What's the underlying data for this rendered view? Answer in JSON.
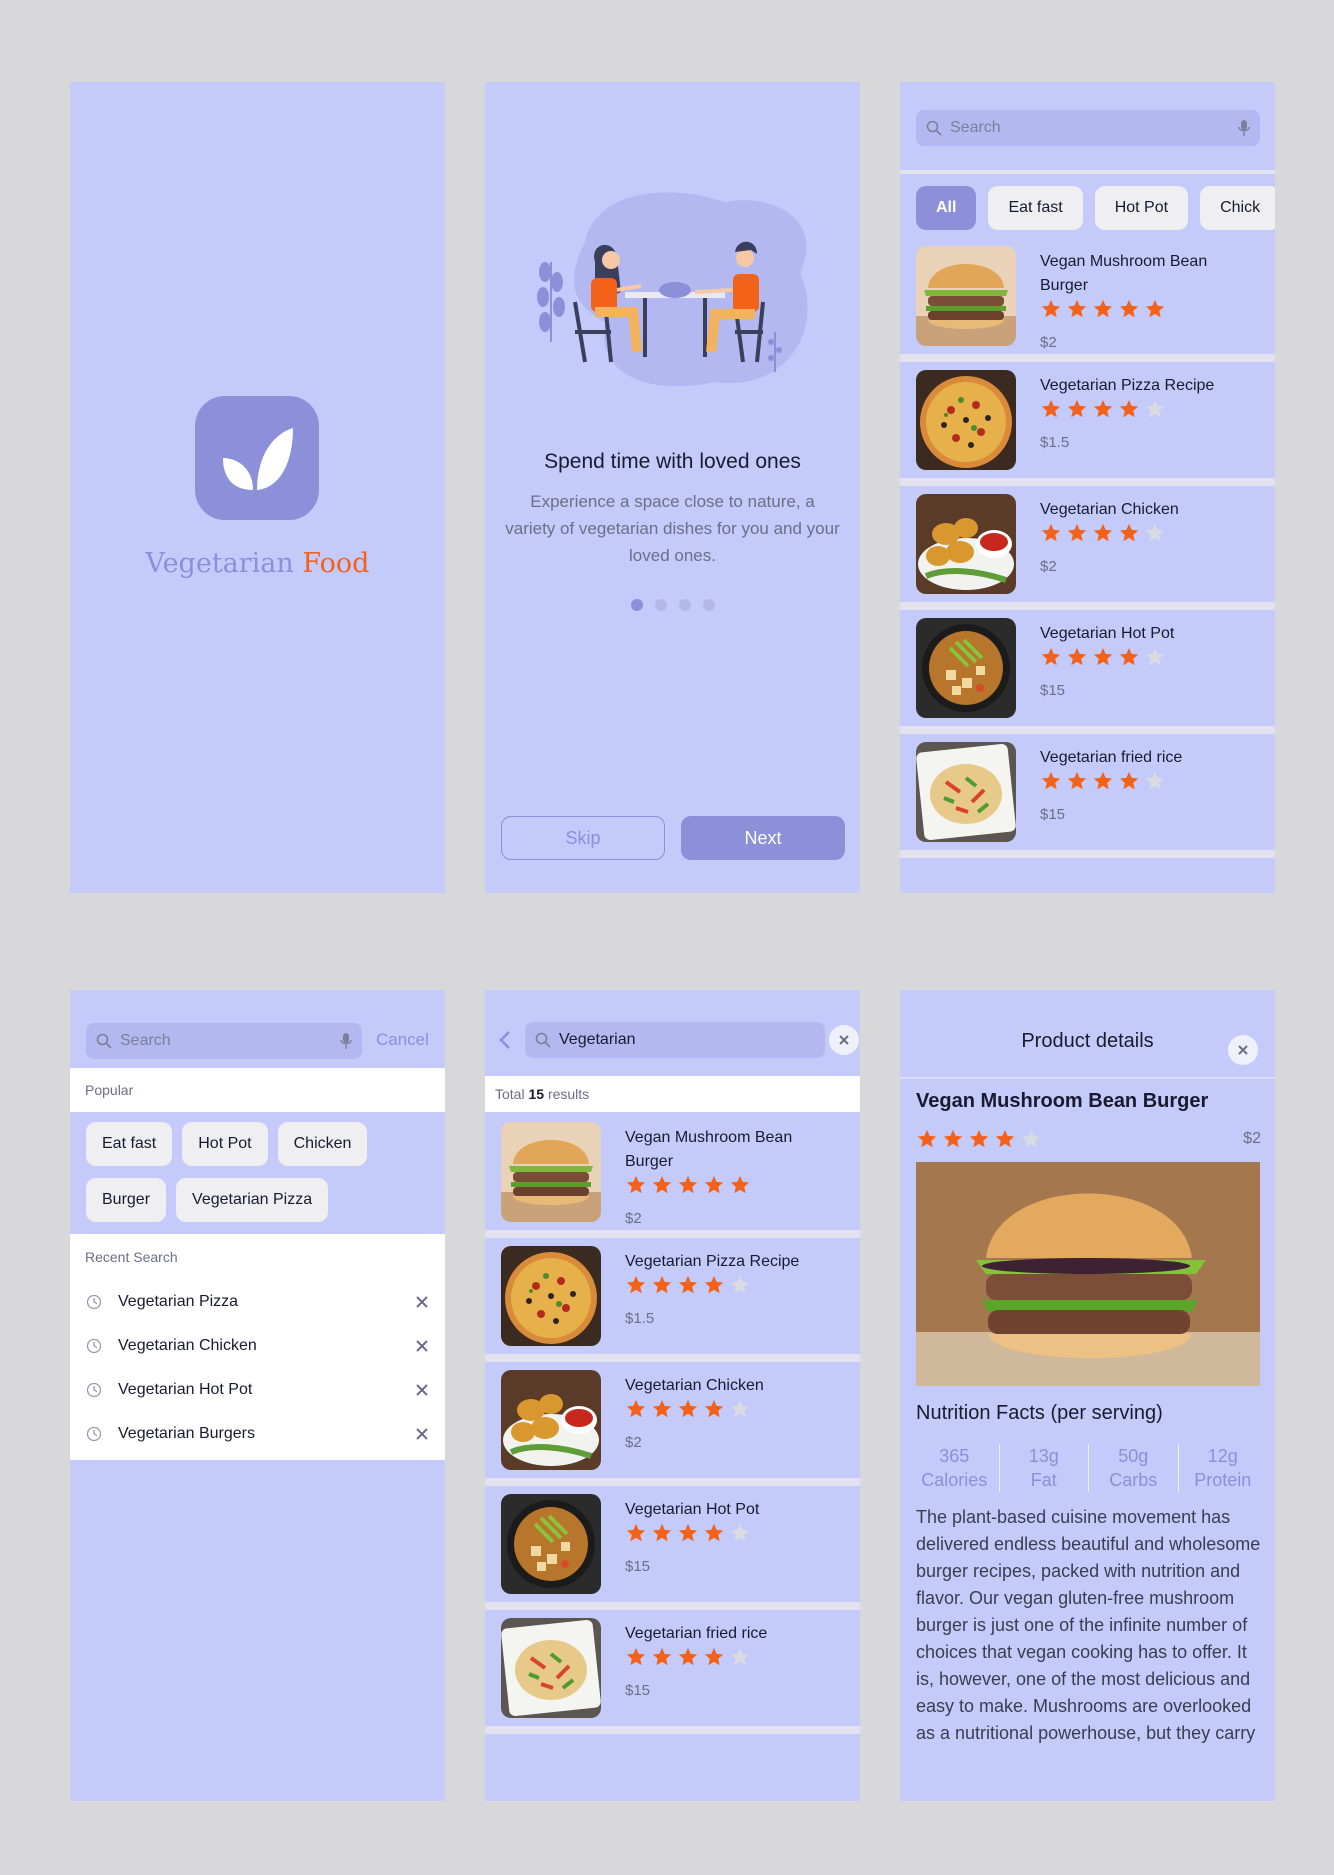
{
  "splash": {
    "brand_part1": "Vegetarian",
    "brand_part2": "Food"
  },
  "onboarding": {
    "title": "Spend time with loved ones",
    "description": "Experience a space close to nature, a variety of vegetarian dishes for you and your loved ones.",
    "page_count": 4,
    "active_page": 1,
    "skip_label": "Skip",
    "next_label": "Next"
  },
  "browse": {
    "search_placeholder": "Search",
    "chips": [
      "All",
      "Eat fast",
      "Hot Pot",
      "Chick"
    ],
    "active_chip": "All"
  },
  "products": [
    {
      "name": "Vegan Mushroom Bean Burger",
      "rating": 5,
      "price": "$2",
      "image": "burger"
    },
    {
      "name": "Vegetarian Pizza Recipe",
      "rating": 4,
      "price": "$1.5",
      "image": "pizza"
    },
    {
      "name": "Vegetarian Chicken",
      "rating": 4,
      "price": "$2",
      "image": "nuggets"
    },
    {
      "name": "Vegetarian Hot Pot",
      "rating": 4,
      "price": "$15",
      "image": "hotpot"
    },
    {
      "name": "Vegetarian fried rice",
      "rating": 4,
      "price": "$15",
      "image": "friedrice"
    }
  ],
  "search": {
    "placeholder": "Search",
    "cancel_label": "Cancel",
    "popular_label": "Popular",
    "popular_chips": [
      "Eat fast",
      "Hot Pot",
      "Chicken",
      "Burger",
      "Vegetarian Pizza"
    ],
    "recent_label": "Recent Search",
    "recent_items": [
      "Vegetarian Pizza",
      "Vegetarian Chicken",
      "Vegetarian Hot Pot",
      "Vegetarian Burgers"
    ]
  },
  "results": {
    "query": "Vegetarian",
    "total_prefix": "Total",
    "total_count": "15",
    "total_suffix": "results"
  },
  "details": {
    "header": "Product details",
    "name": "Vegan Mushroom Bean Burger",
    "rating": 4,
    "price": "$2",
    "nutrition_title": "Nutrition Facts (per serving)",
    "nutrition": [
      {
        "value": "365",
        "label": "Calories"
      },
      {
        "value": "13g",
        "label": "Fat"
      },
      {
        "value": "50g",
        "label": "Carbs"
      },
      {
        "value": "12g",
        "label": "Protein"
      }
    ],
    "description": "The plant-based cuisine movement has delivered endless beautiful and wholesome burger recipes, packed with nutrition and flavor. Our vegan gluten-free mushroom burger is just one of the infinite number of choices that vegan cooking has to offer. It is, however, one of the most delicious and easy to make. Mushrooms are overlooked as a nutritional powerhouse, but they carry"
  },
  "colors": {
    "accent": "#8b90d9",
    "background": "#c4cbfb",
    "brand_orange": "#f4621a",
    "star": "#f4621a",
    "star_empty": "#d9dbe3"
  }
}
